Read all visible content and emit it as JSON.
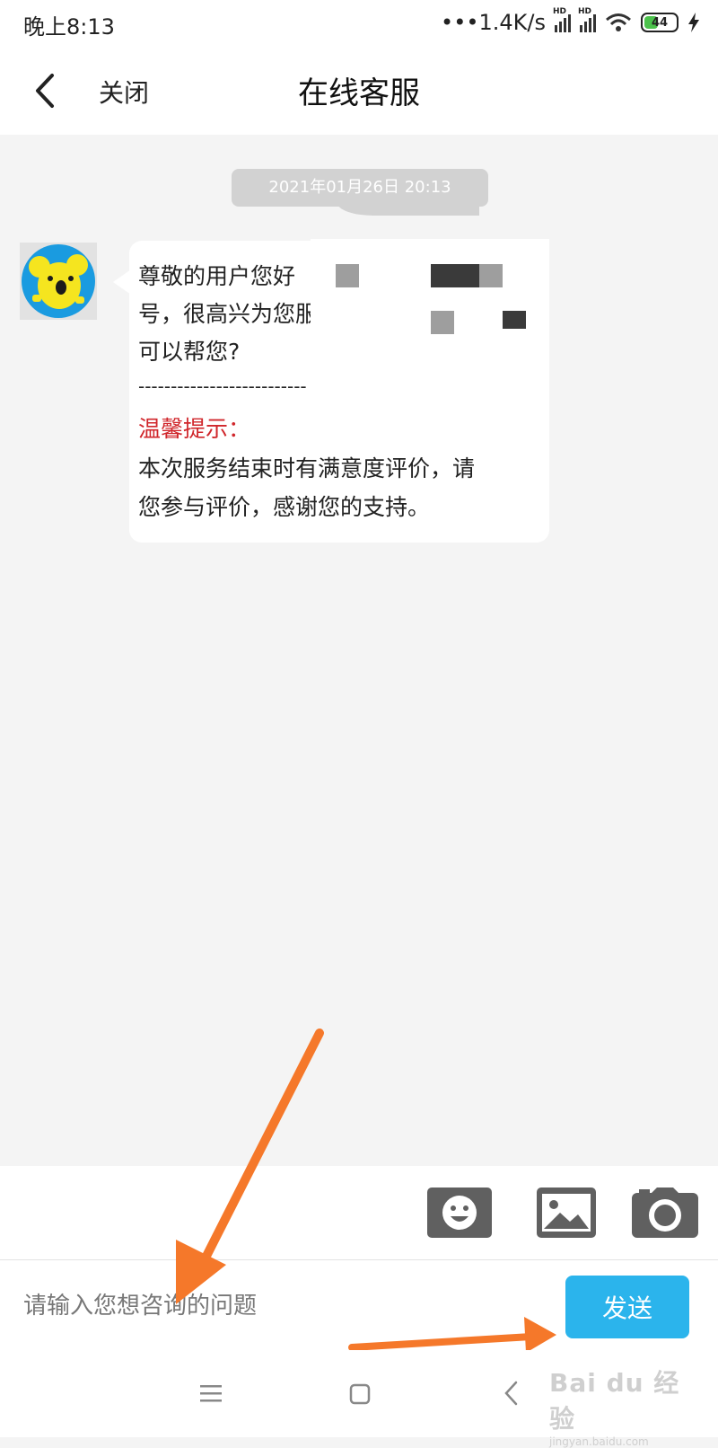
{
  "status_bar": {
    "time": "晚上8:13",
    "network_speed": "•••1.4K/s",
    "signal_label": "HD",
    "battery": "44",
    "icons": [
      "signal-icon",
      "wifi-icon",
      "battery-icon",
      "charging-icon"
    ]
  },
  "header": {
    "back_icon": "chevron-left-icon",
    "close_label": "关闭",
    "title": "在线客服"
  },
  "chat": {
    "timestamp": "2021年01月26日 20:13",
    "message": {
      "line1": "尊敬的用户您好",
      "line2": "号，很高兴为您服",
      "line3": "可以帮您?",
      "divider": "--------------------------",
      "tip_label": "温馨提示：",
      "tip_line1": "本次服务结束时有满意度评价，请",
      "tip_line2": "您参与评价，感谢您的支持。"
    }
  },
  "toolbar": {
    "icons": [
      "emoji-icon",
      "image-icon",
      "camera-icon"
    ]
  },
  "input": {
    "placeholder": "请输入您想咨询的问题",
    "send_label": "发送"
  },
  "nav_bar": {
    "icons": [
      "menu-icon",
      "home-icon",
      "back-icon"
    ]
  },
  "watermark": {
    "main": "Bai du 经验",
    "sub": "jingyan.baidu.com"
  },
  "colors": {
    "accent": "#2bb4ec",
    "tip": "#d0262b",
    "annotation_arrow": "#f5782a",
    "background": "#f4f4f4"
  }
}
